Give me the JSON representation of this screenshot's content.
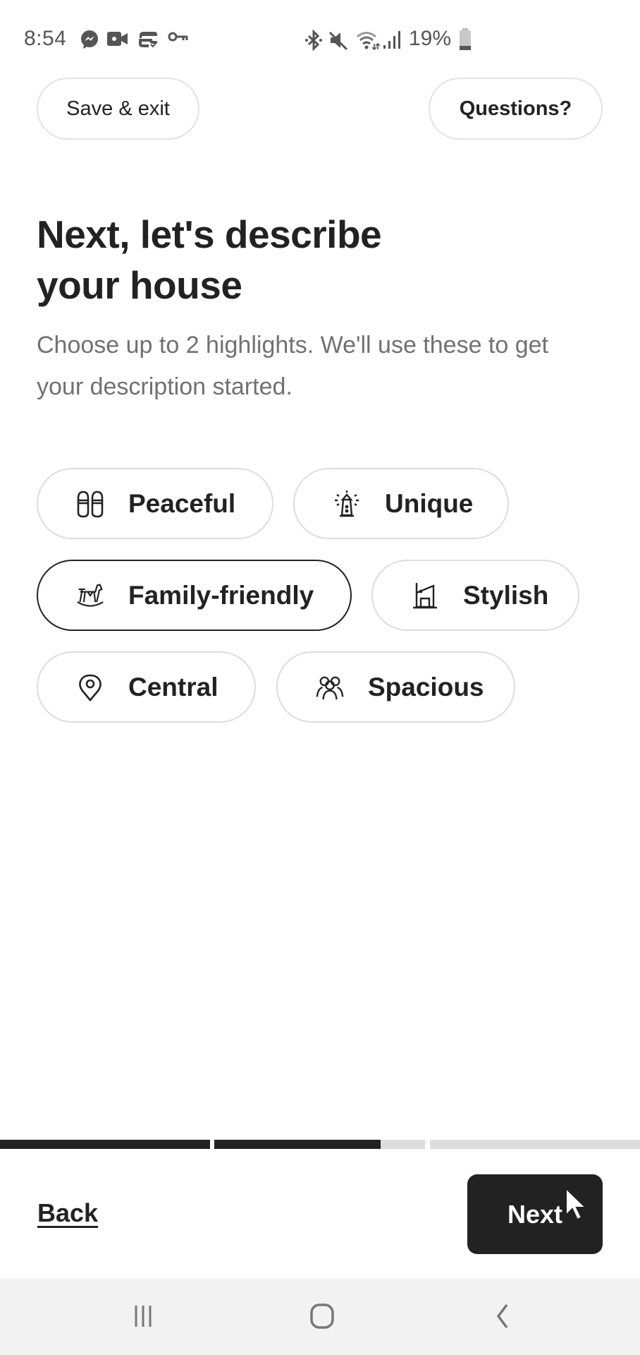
{
  "status_bar": {
    "time": "8:54",
    "left_icons": [
      "messenger-icon",
      "video-call-icon",
      "sync-icon",
      "vpn-key-icon"
    ],
    "right_icons": [
      "bluetooth-icon",
      "mute-icon",
      "wifi-icon",
      "signal-icon"
    ],
    "battery_percent": "19%"
  },
  "header": {
    "save_exit_label": "Save & exit",
    "questions_label": "Questions?"
  },
  "main": {
    "title_line1": "Next, let's describe",
    "title_line2": "your house",
    "subtitle": "Choose up to 2 highlights. We'll use these to get your description started.",
    "highlights": [
      {
        "label": "Peaceful",
        "icon": "slippers-icon",
        "selected": false
      },
      {
        "label": "Unique",
        "icon": "lighthouse-icon",
        "selected": false
      },
      {
        "label": "Family-friendly",
        "icon": "rocking-horse-icon",
        "selected": true
      },
      {
        "label": "Stylish",
        "icon": "modern-house-icon",
        "selected": false
      },
      {
        "label": "Central",
        "icon": "map-pin-icon",
        "selected": false
      },
      {
        "label": "Spacious",
        "icon": "people-group-icon",
        "selected": false
      }
    ]
  },
  "progress": {
    "steps": 3,
    "step_fills": [
      1.0,
      0.79,
      0.0
    ]
  },
  "footer": {
    "back_label": "Back",
    "next_label": "Next"
  },
  "nav_bar": {
    "buttons": [
      "recent-apps-icon",
      "home-icon",
      "back-icon"
    ]
  },
  "colors": {
    "text_primary": "#222222",
    "text_secondary": "#717171",
    "chip_border": "#dddddd",
    "progress_track": "#dddddd",
    "button_dark": "#222222",
    "nav_bar_bg": "#f2f2f2"
  }
}
